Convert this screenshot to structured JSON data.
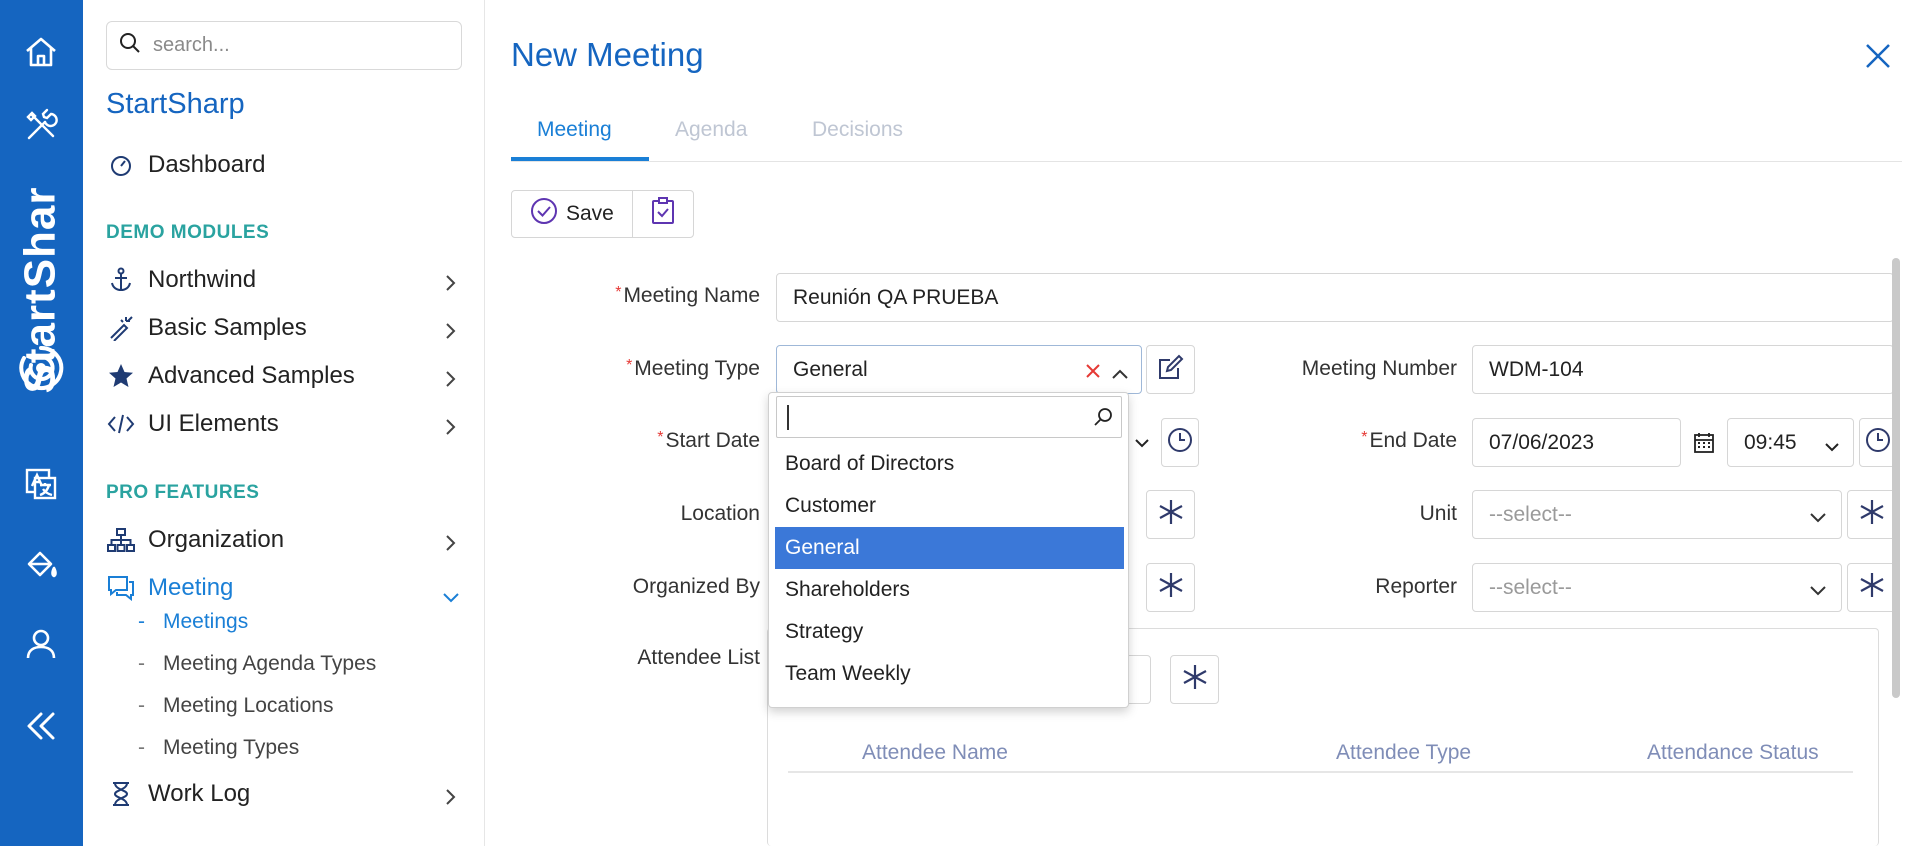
{
  "rail": {
    "brand": "StartShar",
    "icons": [
      "home-icon",
      "tools-icon",
      "brand-logo-icon",
      "translate-icon",
      "paint-bucket-icon",
      "user-icon",
      "collapse-icon"
    ]
  },
  "sidemenu": {
    "search_placeholder": "search...",
    "app_title": "StartSharp",
    "dashboard": "Dashboard",
    "demo_modules_title": "DEMO MODULES",
    "northwind": "Northwind",
    "basic_samples": "Basic Samples",
    "advanced_samples": "Advanced Samples",
    "ui_elements": "UI Elements",
    "pro_features_title": "PRO FEATURES",
    "organization": "Organization",
    "meeting": "Meeting",
    "meeting_sub": [
      "Meetings",
      "Meeting Agenda Types",
      "Meeting Locations",
      "Meeting Types"
    ],
    "work_log": "Work Log"
  },
  "dialog": {
    "title": "New Meeting",
    "tabs": [
      "Meeting",
      "Agenda",
      "Decisions"
    ],
    "save_label": "Save",
    "meeting_name_label": "Meeting Name",
    "meeting_name_value": "Reunión QA PRUEBA",
    "meeting_type_label": "Meeting Type",
    "meeting_type_value": "General",
    "meeting_number_label": "Meeting Number",
    "meeting_number_value": "WDM-104",
    "start_date_label": "Start Date",
    "end_date_label": "End Date",
    "end_date_value": "07/06/2023",
    "end_time_value": "09:45",
    "location_label": "Location",
    "unit_label": "Unit",
    "unit_placeholder": "--select--",
    "organized_by_label": "Organized By",
    "reporter_label": "Reporter",
    "reporter_placeholder": "--select--",
    "attendee_list_label": "Attendee List",
    "attendee_columns": [
      "Attendee Name",
      "Attendee Type",
      "Attendance Status"
    ]
  },
  "dropdown": {
    "selected": "General",
    "options": [
      "Board of Directors",
      "Customer",
      "General",
      "Shareholders",
      "Strategy",
      "Team Weekly"
    ]
  },
  "colors": {
    "brand_blue": "#1565c0",
    "accent_blue": "#1a7fd6",
    "section_teal": "#2aa3a0",
    "selected_option": "#3b78d8",
    "required_red": "#e53935"
  }
}
